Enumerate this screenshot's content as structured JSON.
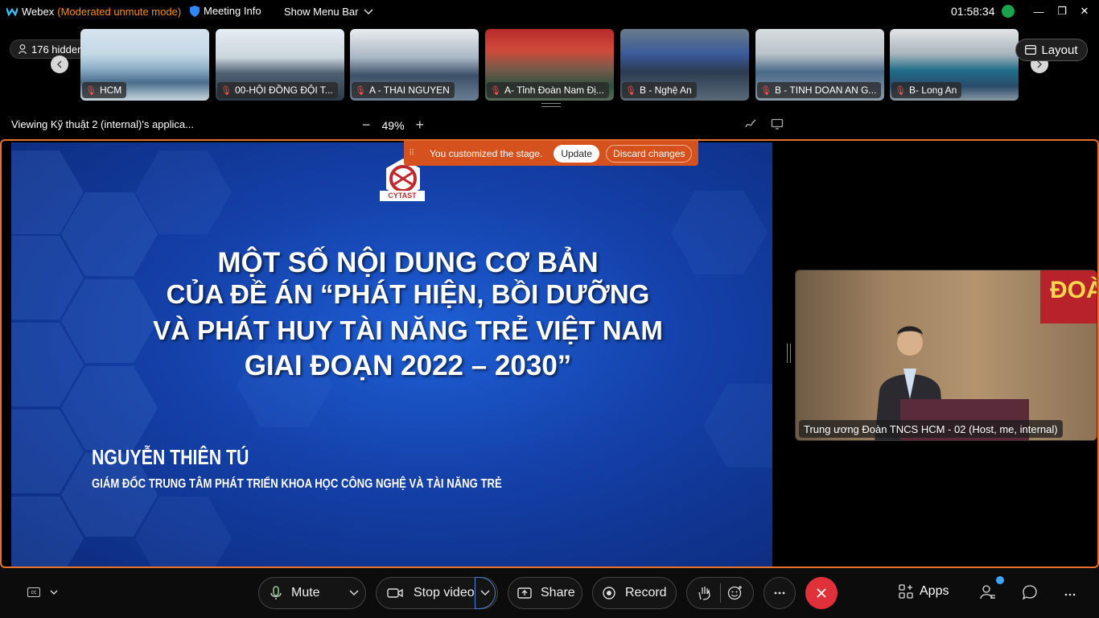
{
  "titlebar": {
    "app_name": "Webex",
    "mode": "(Moderated unmute mode)",
    "meeting_info": "Meeting Info",
    "show_menu": "Show Menu Bar",
    "time": "01:58:34",
    "minimize": "—",
    "restore": "❐",
    "close": "✕"
  },
  "participants": {
    "hidden": "176 hidden",
    "thumbnails": [
      {
        "label": "HCM"
      },
      {
        "label": "00-HỘI ĐỒNG ĐỘI T..."
      },
      {
        "label": "A - THAI NGUYEN"
      },
      {
        "label": "A- Tỉnh Đoàn Nam Đị..."
      },
      {
        "label": "B - Nghệ An"
      },
      {
        "label": "B - TINH DOAN AN G..."
      },
      {
        "label": "B- Long An"
      }
    ],
    "layout": "Layout"
  },
  "share": {
    "viewing": "Viewing Kỹ thuật 2 (internal)'s applica...",
    "zoom": "49%",
    "zoom_out": "−",
    "zoom_in": "+"
  },
  "banner": {
    "text": "You customized the stage.",
    "update": "Update",
    "discard": "Discard changes"
  },
  "slide": {
    "logo_text": "CYTAST",
    "line1": "MỘT SỐ NỘI DUNG CƠ BẢN",
    "line2": "CỦA ĐỀ ÁN “PHÁT HIỆN, BỒI DƯỠNG",
    "line3": "VÀ PHÁT HUY TÀI NĂNG TRẺ VIỆT NAM",
    "line4": "GIAI ĐOẠN 2022 – 2030”",
    "speaker": "NGUYỄN THIÊN TÚ",
    "role": "GIÁM ĐỐC TRUNG TÂM PHÁT TRIỂN KHOA HỌC CÔNG NGHỆ VÀ TÀI NĂNG TRẺ"
  },
  "self_video": {
    "sign": "ĐOÀ",
    "label": "Trung ương Đoàn TNCS HCM - 02 (Host, me, internal)"
  },
  "controls": {
    "mute": "Mute",
    "stop_video": "Stop video",
    "share": "Share",
    "record": "Record",
    "apps": "Apps"
  },
  "colors": {
    "accent_orange": "#e8702a",
    "banner": "#d5521f",
    "leave_red": "#e0303a",
    "mic_off": "#ff5050"
  }
}
